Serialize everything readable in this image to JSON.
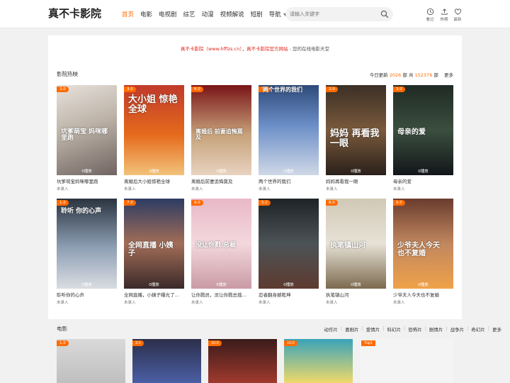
{
  "header": {
    "logo": "真不卡影院",
    "nav": [
      {
        "label": "首页",
        "active": true
      },
      {
        "label": "电影",
        "active": false
      },
      {
        "label": "电视剧",
        "active": false
      },
      {
        "label": "综艺",
        "active": false
      },
      {
        "label": "动漫",
        "active": false
      },
      {
        "label": "视频解说",
        "active": false
      },
      {
        "label": "短剧",
        "active": false
      },
      {
        "label": "导航",
        "active": false
      }
    ],
    "search_placeholder": "请输入关键字",
    "icons": [
      {
        "icon": "history-icon",
        "label": "看过"
      },
      {
        "icon": "upload-icon",
        "label": "热榜"
      },
      {
        "icon": "heart-icon",
        "label": "最新"
      }
    ]
  },
  "notice": {
    "site": "真不卡影院（www.hfflzs.cn）",
    "mid": "真不卡影院官方网站",
    "tail": " - 您的在线电影天堂"
  },
  "hot": {
    "title": "影院热映",
    "today_label": "今日更新",
    "today_count": "2026",
    "unit1": "部",
    "total_label": "共",
    "total_count": "152376",
    "unit2": "部",
    "more": "更多",
    "items": [
      {
        "title": "坑爹萌宝妈咪哪里跑",
        "sub": "未录入",
        "badge": "3.0",
        "views": "0播放",
        "poster_text": "坑爹萌宝 妈咪哪里跑"
      },
      {
        "title": "离婚后大小姐惊艳全球",
        "sub": "未录入",
        "badge": "3.0",
        "views": "0播放",
        "poster_text": "大小姐 惊艳全球"
      },
      {
        "title": "离婚后前妻追悔莫及",
        "sub": "未录入",
        "badge": "8.0",
        "views": "0播放",
        "poster_text": "离婚后 前妻追悔莫及"
      },
      {
        "title": "两个世界的我们",
        "sub": "未录入",
        "badge": "7.0",
        "views": "0播放",
        "poster_text": "两个世界的我们"
      },
      {
        "title": "妈妈再看我一眼",
        "sub": "未录入",
        "badge": "2.0",
        "views": "0播放",
        "poster_text": "妈妈 再看我一眼"
      },
      {
        "title": "母亲的爱",
        "sub": "未录入",
        "badge": "3.0",
        "views": "0播放",
        "poster_text": "母亲的爱"
      },
      {
        "title": "聆听你的心声",
        "sub": "未录入",
        "badge": "1.0",
        "views": "0播放",
        "poster_text": "聆听 你的心声"
      },
      {
        "title": "全网直播，小姨子曝光了…",
        "sub": "未录入",
        "badge": "7.0",
        "views": "0播放",
        "poster_text": "全网直播 小姨子"
      },
      {
        "title": "让你戮员，没让你戮总裁…",
        "sub": "未录入",
        "badge": "9.0",
        "views": "0播放",
        "poster_text": "没让你戮 总裁"
      },
      {
        "title": "忍者翻身撼乾坤",
        "sub": "未录入",
        "badge": "5.0",
        "views": "0播放",
        "poster_text": ""
      },
      {
        "title": "执笔镇山河",
        "sub": "未录入",
        "badge": "8.0",
        "views": "0播放",
        "poster_text": "执笔镇山河"
      },
      {
        "title": "少爷夫人今天也不复婚",
        "sub": "未录入",
        "badge": "9.0",
        "views": "0播放",
        "poster_text": "少爷夫人今天 也不复婚"
      }
    ]
  },
  "movies": {
    "title": "电影",
    "categories": [
      "动作片",
      "喜剧片",
      "爱情片",
      "科幻片",
      "恐怖片",
      "剧情片",
      "战争片",
      "奇幻片"
    ],
    "more": "更多",
    "badges": [
      "1.0",
      "3.0",
      "10.0",
      "10.0",
      "Top1"
    ]
  }
}
